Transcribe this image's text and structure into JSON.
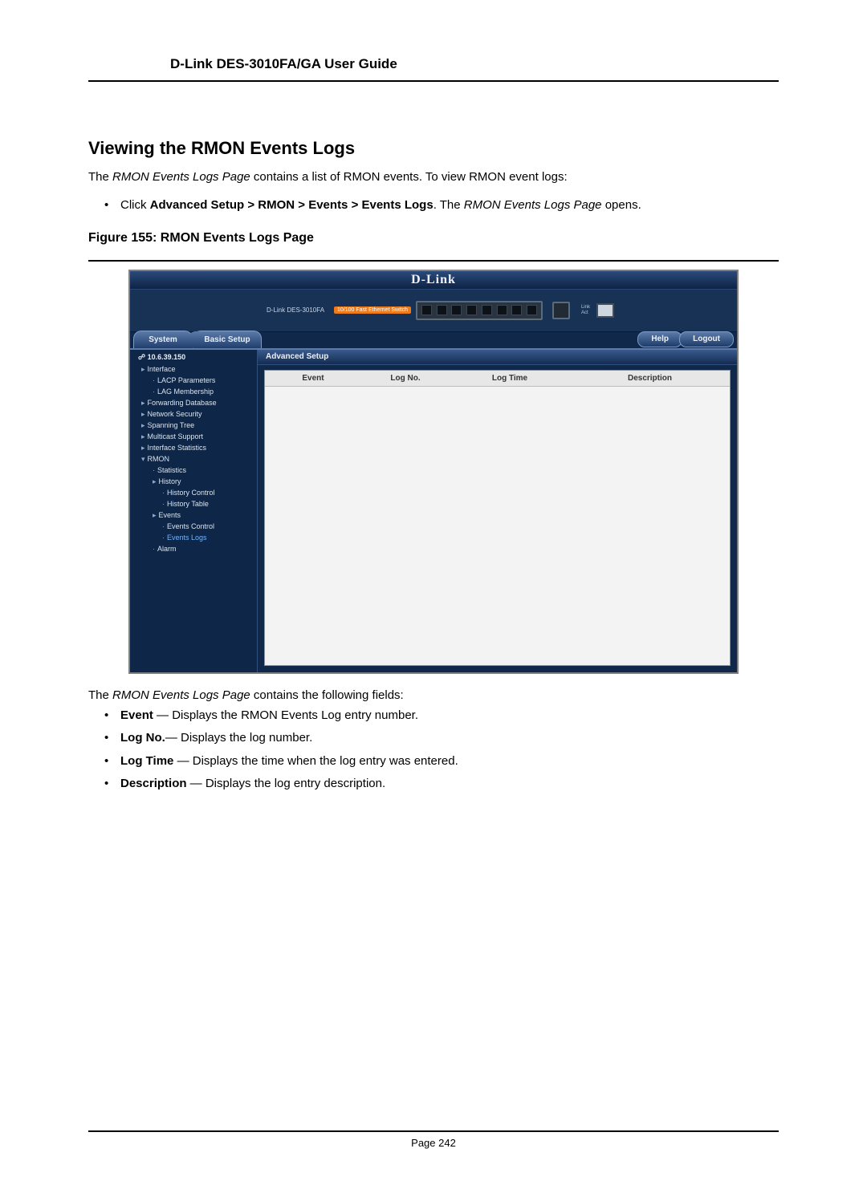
{
  "doc": {
    "header": "D-Link DES-3010FA/GA User Guide",
    "section_title": "Viewing the RMON Events Logs",
    "intro_pre": "The ",
    "intro_em": "RMON Events Logs Page",
    "intro_post": " contains a list of RMON events. To view RMON event logs:",
    "step_pre": "Click ",
    "step_bold": "Advanced Setup > RMON > Events > Events Logs",
    "step_mid": ". The ",
    "step_em": "RMON Events Logs Page",
    "step_post": " opens.",
    "fig_caption": "Figure 155: RMON Events Logs Page",
    "after_pre": "The ",
    "after_em": "RMON Events Logs Page",
    "after_post": " contains the following fields:",
    "fields": [
      {
        "name": "Event",
        "desc": " — Displays the RMON Events Log entry number."
      },
      {
        "name": "Log No.",
        "desc": "— Displays the log number."
      },
      {
        "name": "Log Time",
        "desc": " — Displays the time when the log entry was entered."
      },
      {
        "name": "Description",
        "desc": " — Displays the log entry description."
      }
    ],
    "page_no": "Page 242"
  },
  "ui": {
    "logo": "D-Link",
    "device_label": "D-Link DES-3010FA",
    "device_badge": "10/100 Fast Ethernet Switch",
    "tabs": {
      "system": "System",
      "basic": "Basic Setup"
    },
    "buttons": {
      "help": "Help",
      "logout": "Logout"
    },
    "crumb": "Advanced Setup",
    "ip": "10.6.39.150",
    "nav": [
      {
        "l": "cl",
        "t": "Interface"
      },
      {
        "l": "lf",
        "t": "LACP Parameters"
      },
      {
        "l": "lf",
        "t": "LAG Membership"
      },
      {
        "l": "cl",
        "t": "Forwarding Database"
      },
      {
        "l": "cl",
        "t": "Network Security"
      },
      {
        "l": "cl",
        "t": "Spanning Tree"
      },
      {
        "l": "cl",
        "t": "Multicast Support"
      },
      {
        "l": "cl",
        "t": "Interface Statistics"
      },
      {
        "l": "op",
        "t": "RMON"
      },
      {
        "l": "lf",
        "t": "Statistics"
      },
      {
        "l": "opn",
        "t": "History"
      },
      {
        "l": "lf2",
        "t": "History Control"
      },
      {
        "l": "lf2",
        "t": "History Table"
      },
      {
        "l": "opn",
        "t": "Events"
      },
      {
        "l": "lf2",
        "t": "Events Control"
      },
      {
        "l": "lf2 sel",
        "t": "Events Logs"
      },
      {
        "l": "lf",
        "t": "Alarm"
      }
    ],
    "cols": {
      "c1": "Event",
      "c2": "Log No.",
      "c3": "Log Time",
      "c4": "Description"
    }
  }
}
